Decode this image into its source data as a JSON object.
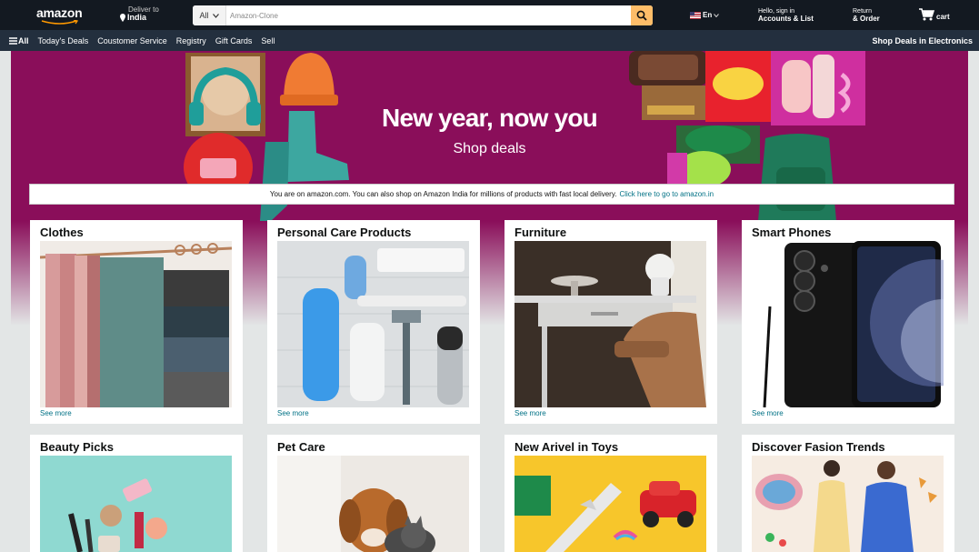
{
  "header": {
    "logo": "amazon",
    "deliver_to_label": "Deliver to",
    "deliver_to_location": "India",
    "search_category": "All",
    "search_placeholder": "Amazon-Clone",
    "language": "En",
    "account_line1": "Hello, sign in",
    "account_line2": "Accounts & List",
    "orders_line1": "Return",
    "orders_line2": "& Order",
    "cart_label": "cart"
  },
  "subnav": {
    "all": "All",
    "items": [
      "Today's Deals",
      "Coustomer Service",
      "Registry",
      "Gift Cards",
      "Sell"
    ],
    "right": "Shop Deals in Electronics"
  },
  "hero": {
    "title": "New year, now you",
    "subtitle": "Shop deals",
    "notice_text": "You are on amazon.com. You can also shop on Amazon India for millions of products with fast local delivery.",
    "notice_link": "Click here to go to amazon.in"
  },
  "cards": [
    {
      "title": "Clothes",
      "link": "See more"
    },
    {
      "title": "Personal Care Products",
      "link": "See more"
    },
    {
      "title": "Furniture",
      "link": "See more"
    },
    {
      "title": "Smart Phones",
      "link": "See more"
    },
    {
      "title": "Beauty Picks"
    },
    {
      "title": "Pet Care"
    },
    {
      "title": "New Arivel in Toys"
    },
    {
      "title": "Discover Fasion Trends"
    }
  ],
  "colors": {
    "nav_top": "#131921",
    "nav_sub": "#232f3e",
    "search_button": "#febd69",
    "hero_background": "#8a0e5a",
    "link": "#007185"
  }
}
